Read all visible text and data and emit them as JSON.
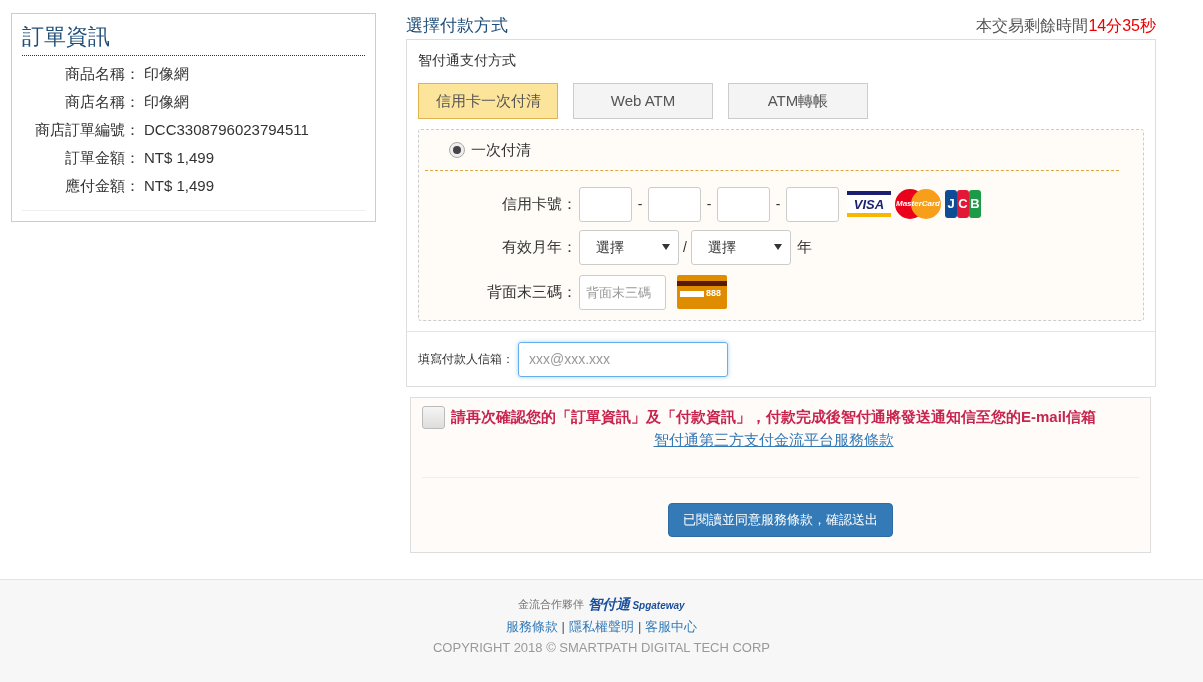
{
  "order_info": {
    "title": "訂單資訊",
    "rows": [
      {
        "label": "商品名稱：",
        "value": "印像網"
      },
      {
        "label": "商店名稱：",
        "value": "印像網"
      },
      {
        "label": "商店訂單編號：",
        "value": "DCC3308796023794511"
      },
      {
        "label": "訂單金額：",
        "value": "NT$ 1,499"
      },
      {
        "label": "應付金額：",
        "value": "NT$ 1,499"
      }
    ]
  },
  "payment": {
    "title": "選擇付款方式",
    "timer_label": "本交易剩餘時間",
    "timer_parts": [
      "14",
      "分",
      "35",
      "秒"
    ],
    "section_title": "智付通支付方式",
    "tabs": [
      {
        "label": "信用卡一次付清",
        "selected": true
      },
      {
        "label": "Web ATM",
        "selected": false
      },
      {
        "label": "ATM轉帳",
        "selected": false
      }
    ],
    "option": {
      "label": "一次付清",
      "selected": true
    },
    "card_number": {
      "label": "信用卡號：",
      "separator": "-",
      "logos": [
        "VISA",
        "MasterCard",
        "JCB"
      ]
    },
    "expiry": {
      "label": "有效月年：",
      "month": "選擇",
      "year": "選擇",
      "separator": "/",
      "suffix": "年"
    },
    "cvv": {
      "label": "背面末三碼：",
      "placeholder": "背面末三碼",
      "hint": "888"
    },
    "email": {
      "label": "填寫付款人信箱：",
      "placeholder": "xxx@xxx.xxx"
    }
  },
  "confirm": {
    "checked": false,
    "message": "請再次確認您的「訂單資訊」及「付款資訊」，付款完成後智付通將發送通知信至您的E-mail信箱",
    "terms_link": "智付通第三方支付金流平台服務條款",
    "submit": "已閱讀並同意服務條款，確認送出"
  },
  "footer": {
    "partner_label": "金流合作夥伴",
    "partner_logo": [
      "智付通",
      "Spgateway"
    ],
    "links": [
      "服務條款",
      "隱私權聲明",
      "客服中心"
    ],
    "link_separator": "|",
    "copyright": "COPYRIGHT 2018 © SMARTPATH DIGITAL TECH CORP"
  }
}
